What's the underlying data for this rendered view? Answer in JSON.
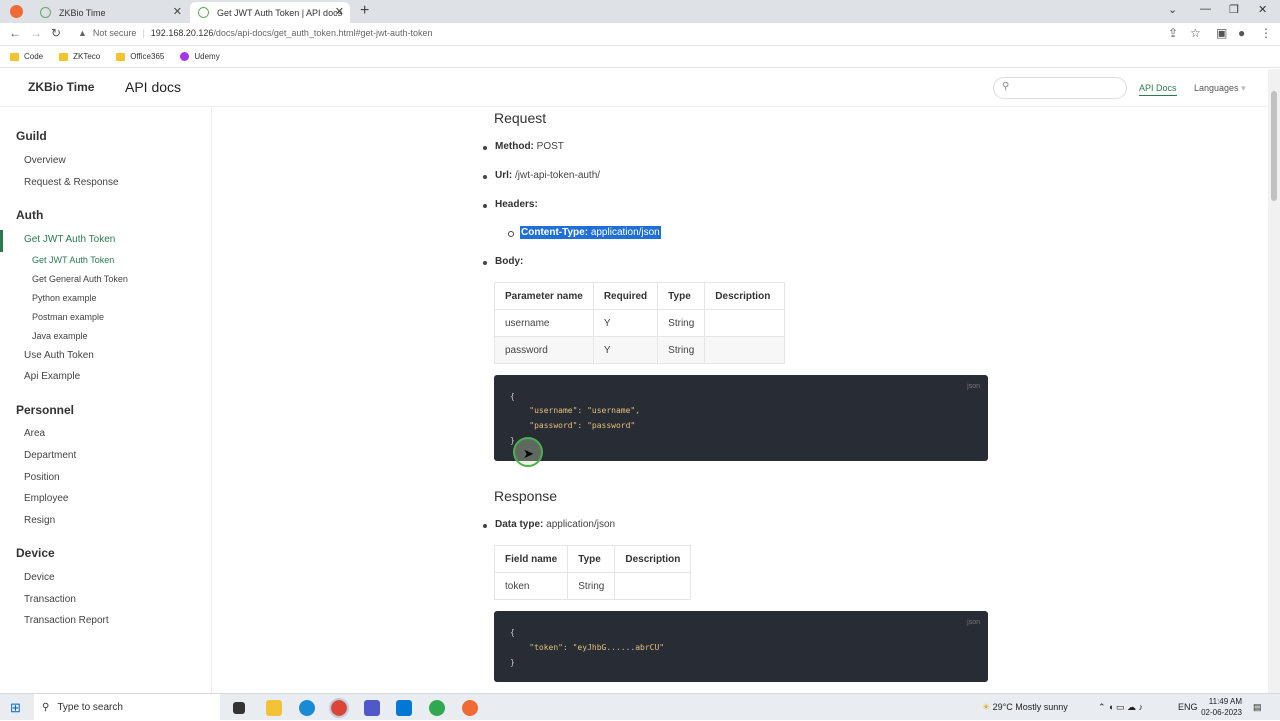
{
  "browser": {
    "tabs": [
      {
        "title": "ZKBio Time"
      },
      {
        "title": "Get JWT Auth Token | API docs"
      }
    ],
    "security": "Not secure",
    "url_host": "192.168.20.126",
    "url_path": "/docs/api-docs/get_auth_token.html#get-jwt-auth-token",
    "bookmarks": [
      "Code",
      "ZKTeco",
      "Office365",
      "Udemy"
    ]
  },
  "header": {
    "brand": "ZKBio Time",
    "title": "API docs",
    "nav": [
      "API Docs",
      "Languages"
    ]
  },
  "sidebar": {
    "sections": [
      {
        "title": "Guild",
        "items": [
          "Overview",
          "Request & Response"
        ]
      },
      {
        "title": "Auth",
        "items": [
          "Get JWT Auth Token"
        ],
        "sub": [
          "Get JWT Auth Token",
          "Get General Auth Token",
          "Python example",
          "Postman example",
          "Java example"
        ],
        "items2": [
          "Use Auth Token",
          "Api Example"
        ]
      },
      {
        "title": "Personnel",
        "items": [
          "Area",
          "Department",
          "Position",
          "Employee",
          "Resign"
        ]
      },
      {
        "title": "Device",
        "items": [
          "Device",
          "Transaction",
          "Transaction Report"
        ]
      }
    ]
  },
  "request": {
    "heading": "Request",
    "method_label": "Method:",
    "method": "POST",
    "url_label": "Url:",
    "url": "/jwt-api-token-auth/",
    "headers_label": "Headers:",
    "header_key": "Content-Type:",
    "header_val": "application/json",
    "body_label": "Body:",
    "table_headers": [
      "Parameter name",
      "Required",
      "Type",
      "Description"
    ],
    "rows": [
      [
        "username",
        "Y",
        "String",
        ""
      ],
      [
        "password",
        "Y",
        "String",
        ""
      ]
    ],
    "code_lang": "json",
    "code_lines": [
      "{",
      "    \"username\": \"username\",",
      "    \"password\": \"password\"",
      "}"
    ]
  },
  "response": {
    "heading": "Response",
    "dtype_label": "Data type:",
    "dtype": "application/json",
    "table_headers": [
      "Field name",
      "Type",
      "Description"
    ],
    "rows": [
      [
        "token",
        "String",
        ""
      ]
    ],
    "code_lang": "json",
    "code_lines": [
      "{",
      "    \"token\": \"eyJhbG......abrCU\"",
      "}"
    ]
  },
  "taskbar": {
    "search": "Type to search",
    "weather": "29°C  Mostly sunny",
    "lang": "ENG",
    "time": "11:49 AM",
    "date": "02-06-2023"
  }
}
